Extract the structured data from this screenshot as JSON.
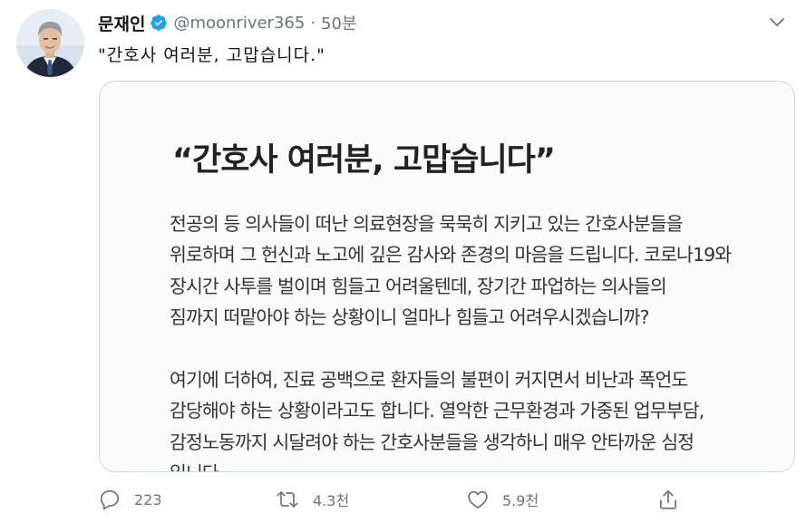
{
  "tweet": {
    "author": {
      "display_name": "문재인",
      "handle": "@moonriver365",
      "verified": true,
      "avatar_icon": "profile-photo-avatar"
    },
    "separator": "·",
    "timestamp": "50분",
    "text": "\"간호사 여러분, 고맙습니다.\"",
    "menu_icon": "chevron-down-icon",
    "card": {
      "title": "“간호사 여러분, 고맙습니다”",
      "paragraphs": [
        [
          "전공의 등 의사들이 떠난 의료현장을 묵묵히 지키고 있는 간호사분들을",
          "위로하며 그 헌신과 노고에 깊은 감사와 존경의 마음을 드립니다. 코로나19와",
          "장시간 사투를 벌이며 힘들고 어려울텐데, 장기간 파업하는 의사들의",
          "짐까지 떠맡아야 하는 상황이니 얼마나 힘들고 어려우시겠습니까?"
        ],
        [
          "여기에 더하여, 진료 공백으로 환자들의 불편이 커지면서 비난과 폭언도",
          "감당해야 하는 상황이라고도 합니다. 열악한 근무환경과 가중된 업무부담,",
          "감정노동까지 시달려야 하는 간호사분들을 생각하니 매우 안타까운 심정",
          "입니다."
        ]
      ]
    },
    "actions": {
      "reply": {
        "icon": "reply-icon",
        "count": "223"
      },
      "retweet": {
        "icon": "retweet-icon",
        "count": "4.3천"
      },
      "like": {
        "icon": "heart-icon",
        "count": "5.9천"
      },
      "share": {
        "icon": "share-icon"
      }
    }
  },
  "colors": {
    "verified_badge": "#1da1f2",
    "secondary_text": "#657786",
    "card_border": "#ccd6dd"
  }
}
